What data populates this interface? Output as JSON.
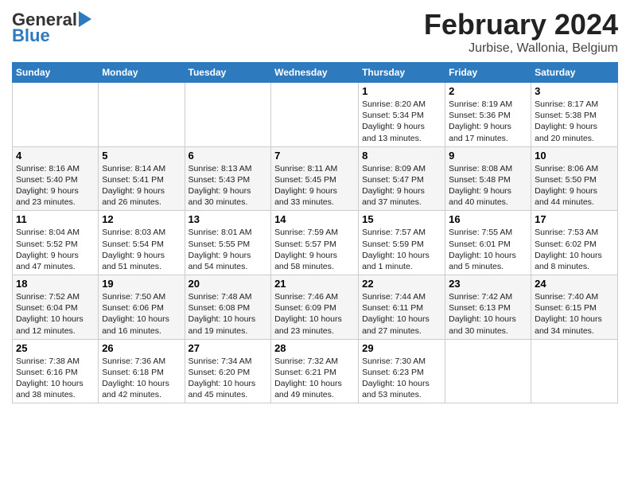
{
  "header": {
    "logo_line1": "General",
    "logo_line2": "Blue",
    "title": "February 2024",
    "subtitle": "Jurbise, Wallonia, Belgium"
  },
  "days_of_week": [
    "Sunday",
    "Monday",
    "Tuesday",
    "Wednesday",
    "Thursday",
    "Friday",
    "Saturday"
  ],
  "weeks": [
    [
      {
        "day": "",
        "info": ""
      },
      {
        "day": "",
        "info": ""
      },
      {
        "day": "",
        "info": ""
      },
      {
        "day": "",
        "info": ""
      },
      {
        "day": "1",
        "info": "Sunrise: 8:20 AM\nSunset: 5:34 PM\nDaylight: 9 hours\nand 13 minutes."
      },
      {
        "day": "2",
        "info": "Sunrise: 8:19 AM\nSunset: 5:36 PM\nDaylight: 9 hours\nand 17 minutes."
      },
      {
        "day": "3",
        "info": "Sunrise: 8:17 AM\nSunset: 5:38 PM\nDaylight: 9 hours\nand 20 minutes."
      }
    ],
    [
      {
        "day": "4",
        "info": "Sunrise: 8:16 AM\nSunset: 5:40 PM\nDaylight: 9 hours\nand 23 minutes."
      },
      {
        "day": "5",
        "info": "Sunrise: 8:14 AM\nSunset: 5:41 PM\nDaylight: 9 hours\nand 26 minutes."
      },
      {
        "day": "6",
        "info": "Sunrise: 8:13 AM\nSunset: 5:43 PM\nDaylight: 9 hours\nand 30 minutes."
      },
      {
        "day": "7",
        "info": "Sunrise: 8:11 AM\nSunset: 5:45 PM\nDaylight: 9 hours\nand 33 minutes."
      },
      {
        "day": "8",
        "info": "Sunrise: 8:09 AM\nSunset: 5:47 PM\nDaylight: 9 hours\nand 37 minutes."
      },
      {
        "day": "9",
        "info": "Sunrise: 8:08 AM\nSunset: 5:48 PM\nDaylight: 9 hours\nand 40 minutes."
      },
      {
        "day": "10",
        "info": "Sunrise: 8:06 AM\nSunset: 5:50 PM\nDaylight: 9 hours\nand 44 minutes."
      }
    ],
    [
      {
        "day": "11",
        "info": "Sunrise: 8:04 AM\nSunset: 5:52 PM\nDaylight: 9 hours\nand 47 minutes."
      },
      {
        "day": "12",
        "info": "Sunrise: 8:03 AM\nSunset: 5:54 PM\nDaylight: 9 hours\nand 51 minutes."
      },
      {
        "day": "13",
        "info": "Sunrise: 8:01 AM\nSunset: 5:55 PM\nDaylight: 9 hours\nand 54 minutes."
      },
      {
        "day": "14",
        "info": "Sunrise: 7:59 AM\nSunset: 5:57 PM\nDaylight: 9 hours\nand 58 minutes."
      },
      {
        "day": "15",
        "info": "Sunrise: 7:57 AM\nSunset: 5:59 PM\nDaylight: 10 hours\nand 1 minute."
      },
      {
        "day": "16",
        "info": "Sunrise: 7:55 AM\nSunset: 6:01 PM\nDaylight: 10 hours\nand 5 minutes."
      },
      {
        "day": "17",
        "info": "Sunrise: 7:53 AM\nSunset: 6:02 PM\nDaylight: 10 hours\nand 8 minutes."
      }
    ],
    [
      {
        "day": "18",
        "info": "Sunrise: 7:52 AM\nSunset: 6:04 PM\nDaylight: 10 hours\nand 12 minutes."
      },
      {
        "day": "19",
        "info": "Sunrise: 7:50 AM\nSunset: 6:06 PM\nDaylight: 10 hours\nand 16 minutes."
      },
      {
        "day": "20",
        "info": "Sunrise: 7:48 AM\nSunset: 6:08 PM\nDaylight: 10 hours\nand 19 minutes."
      },
      {
        "day": "21",
        "info": "Sunrise: 7:46 AM\nSunset: 6:09 PM\nDaylight: 10 hours\nand 23 minutes."
      },
      {
        "day": "22",
        "info": "Sunrise: 7:44 AM\nSunset: 6:11 PM\nDaylight: 10 hours\nand 27 minutes."
      },
      {
        "day": "23",
        "info": "Sunrise: 7:42 AM\nSunset: 6:13 PM\nDaylight: 10 hours\nand 30 minutes."
      },
      {
        "day": "24",
        "info": "Sunrise: 7:40 AM\nSunset: 6:15 PM\nDaylight: 10 hours\nand 34 minutes."
      }
    ],
    [
      {
        "day": "25",
        "info": "Sunrise: 7:38 AM\nSunset: 6:16 PM\nDaylight: 10 hours\nand 38 minutes."
      },
      {
        "day": "26",
        "info": "Sunrise: 7:36 AM\nSunset: 6:18 PM\nDaylight: 10 hours\nand 42 minutes."
      },
      {
        "day": "27",
        "info": "Sunrise: 7:34 AM\nSunset: 6:20 PM\nDaylight: 10 hours\nand 45 minutes."
      },
      {
        "day": "28",
        "info": "Sunrise: 7:32 AM\nSunset: 6:21 PM\nDaylight: 10 hours\nand 49 minutes."
      },
      {
        "day": "29",
        "info": "Sunrise: 7:30 AM\nSunset: 6:23 PM\nDaylight: 10 hours\nand 53 minutes."
      },
      {
        "day": "",
        "info": ""
      },
      {
        "day": "",
        "info": ""
      }
    ]
  ]
}
